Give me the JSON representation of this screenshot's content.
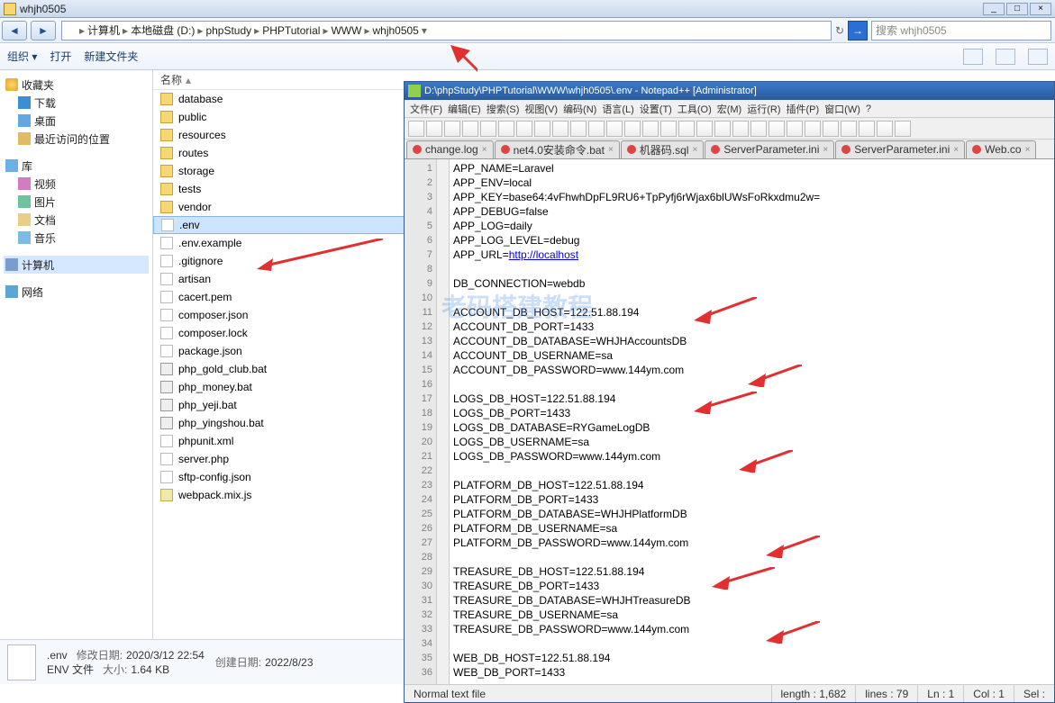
{
  "explorer": {
    "title": "whjh0505",
    "breadcrumb": [
      "计算机",
      "本地磁盘 (D:)",
      "phpStudy",
      "PHPTutorial",
      "WWW",
      "whjh0505"
    ],
    "search_placeholder": "搜索 whjh0505",
    "toolbar": {
      "organize": "组织 ▾",
      "open": "打开",
      "new_folder": "新建文件夹"
    },
    "nav": {
      "favorites": {
        "label": "收藏夹",
        "items": [
          "下载",
          "桌面",
          "最近访问的位置"
        ]
      },
      "libraries": {
        "label": "库",
        "items": [
          "视频",
          "图片",
          "文档",
          "音乐"
        ]
      },
      "computer": {
        "label": "计算机"
      },
      "network": {
        "label": "网络"
      }
    },
    "columns": {
      "name": "名称"
    },
    "files": [
      {
        "name": "database",
        "type": "folder"
      },
      {
        "name": "public",
        "type": "folder"
      },
      {
        "name": "resources",
        "type": "folder"
      },
      {
        "name": "routes",
        "type": "folder"
      },
      {
        "name": "storage",
        "type": "folder"
      },
      {
        "name": "tests",
        "type": "folder"
      },
      {
        "name": "vendor",
        "type": "folder"
      },
      {
        "name": ".env",
        "type": "file",
        "selected": true
      },
      {
        "name": ".env.example",
        "type": "file"
      },
      {
        "name": ".gitignore",
        "type": "file"
      },
      {
        "name": "artisan",
        "type": "file"
      },
      {
        "name": "cacert.pem",
        "type": "file"
      },
      {
        "name": "composer.json",
        "type": "file"
      },
      {
        "name": "composer.lock",
        "type": "file"
      },
      {
        "name": "package.json",
        "type": "file"
      },
      {
        "name": "php_gold_club.bat",
        "type": "bat"
      },
      {
        "name": "php_money.bat",
        "type": "bat"
      },
      {
        "name": "php_yeji.bat",
        "type": "bat"
      },
      {
        "name": "php_yingshou.bat",
        "type": "bat"
      },
      {
        "name": "phpunit.xml",
        "type": "file"
      },
      {
        "name": "server.php",
        "type": "file"
      },
      {
        "name": "sftp-config.json",
        "type": "file"
      },
      {
        "name": "webpack.mix.js",
        "type": "js"
      }
    ],
    "details": {
      "name": ".env",
      "type": "ENV 文件",
      "mod_label": "修改日期:",
      "mod": "2020/3/12 22:54",
      "size_label": "大小:",
      "size": "1.64 KB",
      "create_label": "创建日期:",
      "create": "2022/8/23"
    }
  },
  "npp": {
    "title": "D:\\phpStudy\\PHPTutorial\\WWW\\whjh0505\\.env - Notepad++ [Administrator]",
    "menu": [
      "文件(F)",
      "编辑(E)",
      "搜索(S)",
      "视图(V)",
      "编码(N)",
      "语言(L)",
      "设置(T)",
      "工具(O)",
      "宏(M)",
      "运行(R)",
      "插件(P)",
      "窗口(W)",
      "?"
    ],
    "tabs": [
      "change.log",
      "net4.0安装命令.bat",
      "机器码.sql",
      "ServerParameter.ini",
      "ServerParameter.ini",
      "Web.co"
    ],
    "code": [
      "APP_NAME=Laravel",
      "APP_ENV=local",
      "APP_KEY=base64:4vFhwhDpFL9RU6+TpPyfj6rWjax6blUWsFoRkxdmu2w=",
      "APP_DEBUG=false",
      "APP_LOG=daily",
      "APP_LOG_LEVEL=debug",
      "APP_URL=http://localhost",
      "",
      "DB_CONNECTION=webdb",
      "",
      "ACCOUNT_DB_HOST=122.51.88.194",
      "ACCOUNT_DB_PORT=1433",
      "ACCOUNT_DB_DATABASE=WHJHAccountsDB",
      "ACCOUNT_DB_USERNAME=sa",
      "ACCOUNT_DB_PASSWORD=www.144ym.com",
      "",
      "LOGS_DB_HOST=122.51.88.194",
      "LOGS_DB_PORT=1433",
      "LOGS_DB_DATABASE=RYGameLogDB",
      "LOGS_DB_USERNAME=sa",
      "LOGS_DB_PASSWORD=www.144ym.com",
      "",
      "PLATFORM_DB_HOST=122.51.88.194",
      "PLATFORM_DB_PORT=1433",
      "PLATFORM_DB_DATABASE=WHJHPlatformDB",
      "PLATFORM_DB_USERNAME=sa",
      "PLATFORM_DB_PASSWORD=www.144ym.com",
      "",
      "TREASURE_DB_HOST=122.51.88.194",
      "TREASURE_DB_PORT=1433",
      "TREASURE_DB_DATABASE=WHJHTreasureDB",
      "TREASURE_DB_USERNAME=sa",
      "TREASURE_DB_PASSWORD=www.144ym.com",
      "",
      "WEB_DB_HOST=122.51.88.194",
      "WEB_DB_PORT=1433"
    ],
    "status": {
      "syntax": "Normal text file",
      "length": "length : 1,682",
      "lines": "lines : 79",
      "ln": "Ln : 1",
      "col": "Col : 1",
      "sel": "Sel :"
    }
  }
}
